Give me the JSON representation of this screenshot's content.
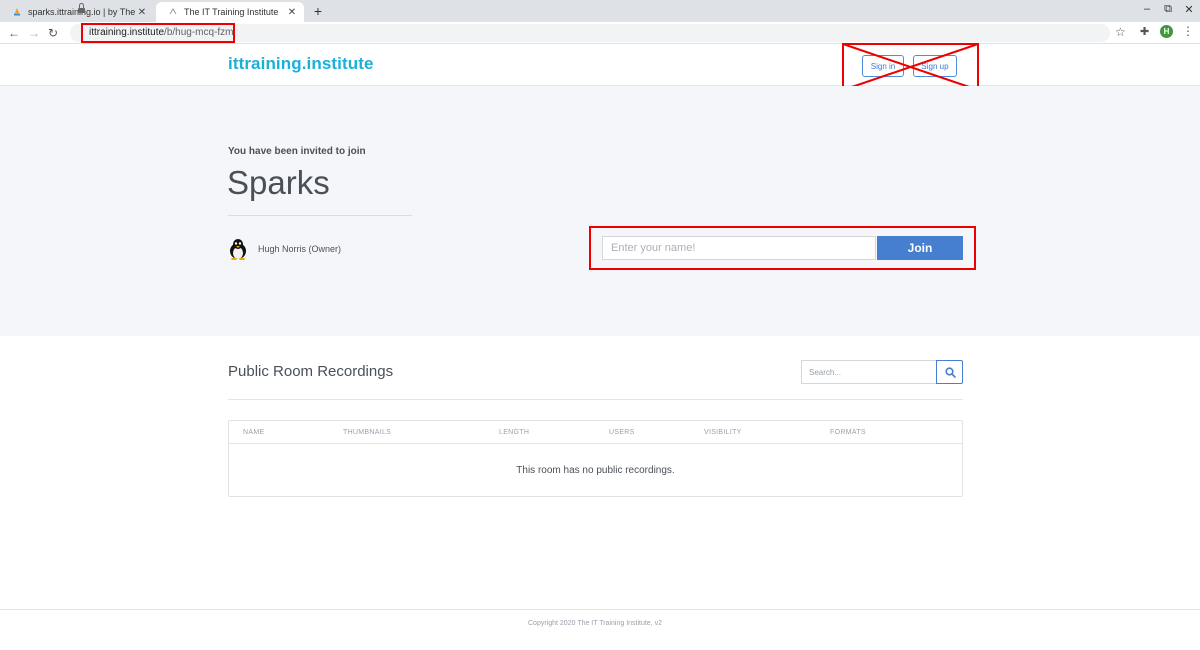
{
  "browser": {
    "tabs": [
      {
        "title": "sparks.ittraining.io | by The IT",
        "active": false
      },
      {
        "title": "The IT Training Institute",
        "active": true
      }
    ],
    "new_tab": "+",
    "url_host": "ittraining.institute",
    "url_path": "/b/hug-mcq-fzm",
    "profile_initial": "H"
  },
  "header": {
    "logo": "ittraining.institute",
    "sign_in": "Sign in",
    "sign_up": "Sign up"
  },
  "hero": {
    "invited_text": "You have been invited to join",
    "room_name": "Sparks",
    "owner": "Hugh Norris (Owner)",
    "name_placeholder": "Enter your name!",
    "join_label": "Join"
  },
  "recordings": {
    "title": "Public Room Recordings",
    "search_placeholder": "Search...",
    "columns": [
      "NAME",
      "THUMBNAILS",
      "LENGTH",
      "USERS",
      "VISIBILITY",
      "FORMATS"
    ],
    "empty_message": "This room has no public recordings."
  },
  "footer": {
    "copyright": "Copyright 2020 The IT Training Institute, v2"
  },
  "colors": {
    "brand": "#1ab0d8",
    "primary": "#467fcf",
    "highlight": "#ee0000"
  }
}
